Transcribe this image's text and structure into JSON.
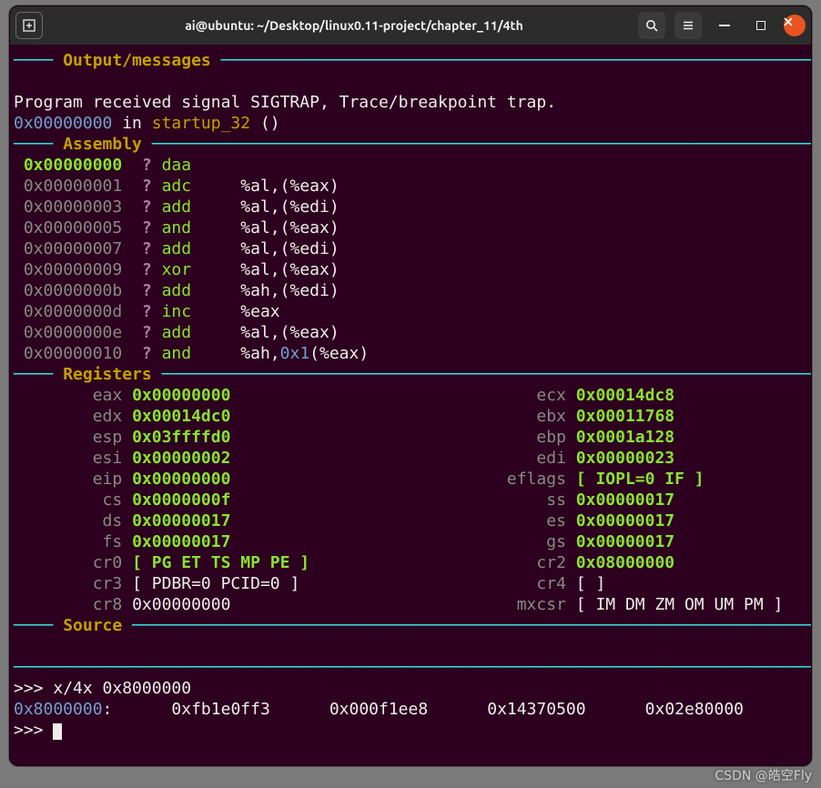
{
  "titlebar": {
    "title": "ai@ubuntu: ~/Desktop/linux0.11-project/chapter_11/4th"
  },
  "sections": {
    "output": "Output/messages",
    "assembly": "Assembly",
    "registers": "Registers",
    "source": "Source"
  },
  "output": {
    "line1": "Program received signal SIGTRAP, Trace/breakpoint trap.",
    "addr": "0x00000000",
    "in": " in ",
    "func": "startup_32",
    "tail": " ()"
  },
  "asm": [
    {
      "addr": "0x00000000",
      "q": "?",
      "op": "daa",
      "args": "",
      "hl": true
    },
    {
      "addr": "0x00000001",
      "q": "?",
      "op": "adc",
      "args": "%al,(%eax)"
    },
    {
      "addr": "0x00000003",
      "q": "?",
      "op": "add",
      "args": "%al,(%edi)"
    },
    {
      "addr": "0x00000005",
      "q": "?",
      "op": "and",
      "args": "%al,(%eax)"
    },
    {
      "addr": "0x00000007",
      "q": "?",
      "op": "add",
      "args": "%al,(%edi)"
    },
    {
      "addr": "0x00000009",
      "q": "?",
      "op": "xor",
      "args": "%al,(%eax)"
    },
    {
      "addr": "0x0000000b",
      "q": "?",
      "op": "add",
      "args": "%ah,(%edi)"
    },
    {
      "addr": "0x0000000d",
      "q": "?",
      "op": "inc",
      "args": "%eax"
    },
    {
      "addr": "0x0000000e",
      "q": "?",
      "op": "add",
      "args": "%al,(%eax)"
    },
    {
      "addr": "0x00000010",
      "q": "?",
      "op": "and",
      "args_pre": "%ah,",
      "args_imm": "0x1",
      "args_post": "(%eax)"
    }
  ],
  "regs_left": [
    {
      "name": "eax",
      "val": "0x00000000"
    },
    {
      "name": "edx",
      "val": "0x00014dc0"
    },
    {
      "name": "esp",
      "val": "0x03ffffd0"
    },
    {
      "name": "esi",
      "val": "0x00000002"
    },
    {
      "name": "eip",
      "val": "0x00000000"
    },
    {
      "name": "cs",
      "val": "0x0000000f"
    },
    {
      "name": "ds",
      "val": "0x00000017"
    },
    {
      "name": "fs",
      "val": "0x00000017"
    },
    {
      "name": "cr0",
      "val": "[ PG ET TS MP PE ]"
    },
    {
      "name": "cr3",
      "val": "[ PDBR=0 PCID=0 ]",
      "plain": true
    },
    {
      "name": "cr8",
      "val": "0x00000000",
      "plain": true
    }
  ],
  "regs_right": [
    {
      "name": "ecx",
      "val": "0x00014dc8"
    },
    {
      "name": "ebx",
      "val": "0x00011768"
    },
    {
      "name": "ebp",
      "val": "0x0001a128"
    },
    {
      "name": "edi",
      "val": "0x00000023"
    },
    {
      "name": "eflags",
      "val": "[ IOPL=0 IF ]"
    },
    {
      "name": "ss",
      "val": "0x00000017"
    },
    {
      "name": "es",
      "val": "0x00000017"
    },
    {
      "name": "gs",
      "val": "0x00000017"
    },
    {
      "name": "cr2",
      "val": "0x08000000"
    },
    {
      "name": "cr4",
      "val": "[ ]",
      "plain": true
    },
    {
      "name": "mxcsr",
      "val": "[ IM DM ZM OM UM PM ]",
      "plain": true
    }
  ],
  "cmd": {
    "prompt": ">>> ",
    "input": "x/4x 0x8000000",
    "result_addr": "0x8000000",
    "result_colon": ":",
    "vals": [
      "0xfb1e0ff3",
      "0x000f1ee8",
      "0x14370500",
      "0x02e80000"
    ]
  },
  "watermark": "CSDN @皓空Fly"
}
